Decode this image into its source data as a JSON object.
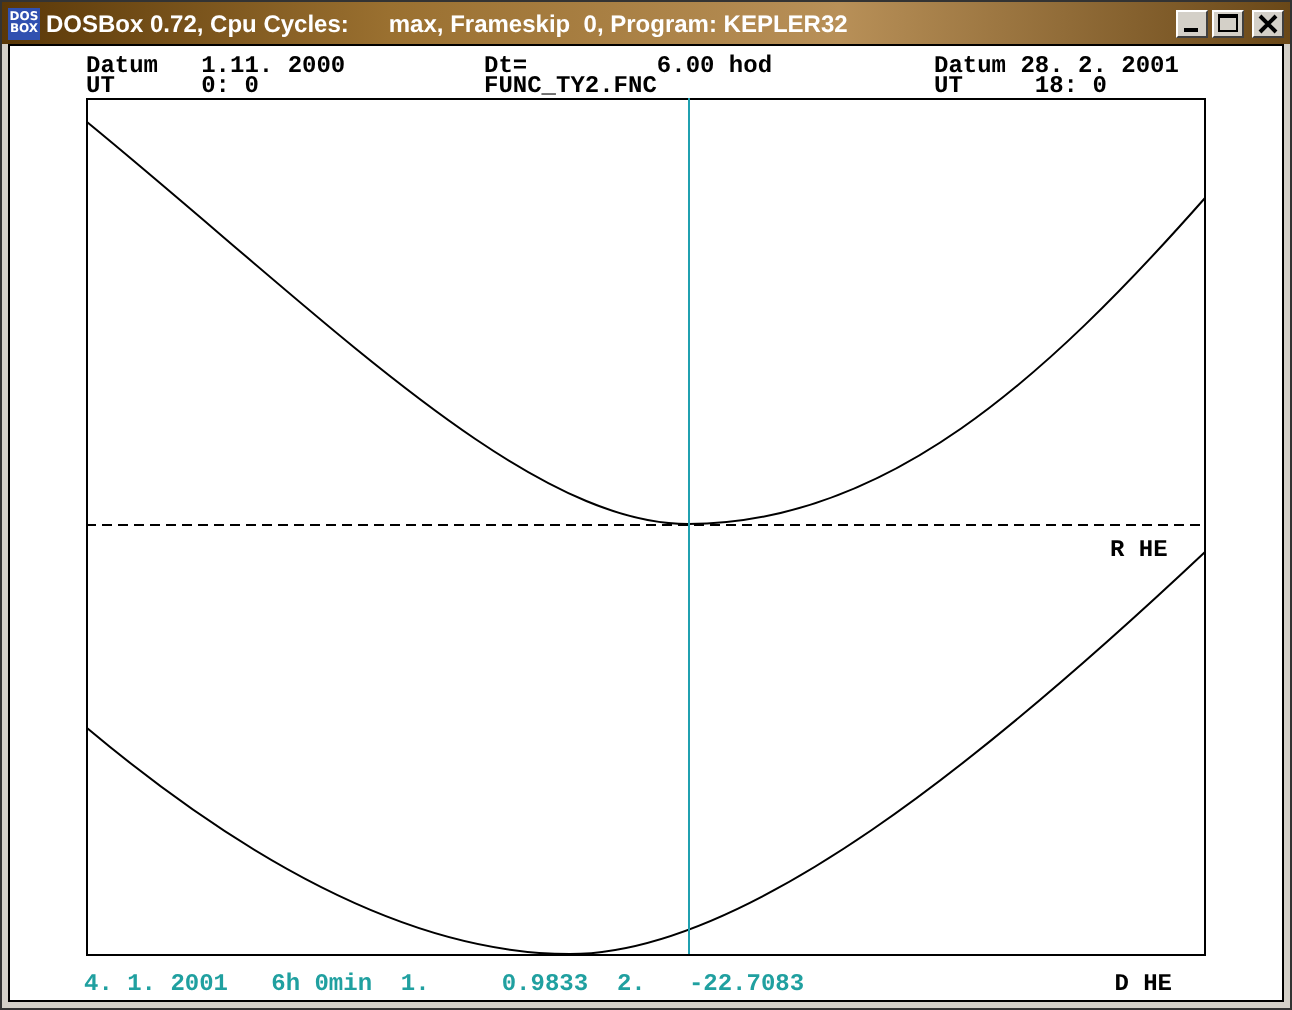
{
  "window": {
    "icon_label": [
      "DOS",
      "BOX"
    ],
    "title": "DOSBox 0.72, Cpu Cycles:      max, Frameskip  0, Program: KEPLER32"
  },
  "header": {
    "left": [
      "Datum   1.11. 2000",
      "UT      0: 0"
    ],
    "middle": [
      "Dt=         6.00 hod",
      "FUNC_TY2.FNC"
    ],
    "right": [
      "Datum 28. 2. 2001",
      "UT     18: 0"
    ]
  },
  "plot": {
    "upper_label": "R HE"
  },
  "footer": {
    "readout": "4. 1. 2001   6h 0min  1.     0.9833  2.   -22.7083",
    "lower_label": "D HE"
  }
}
